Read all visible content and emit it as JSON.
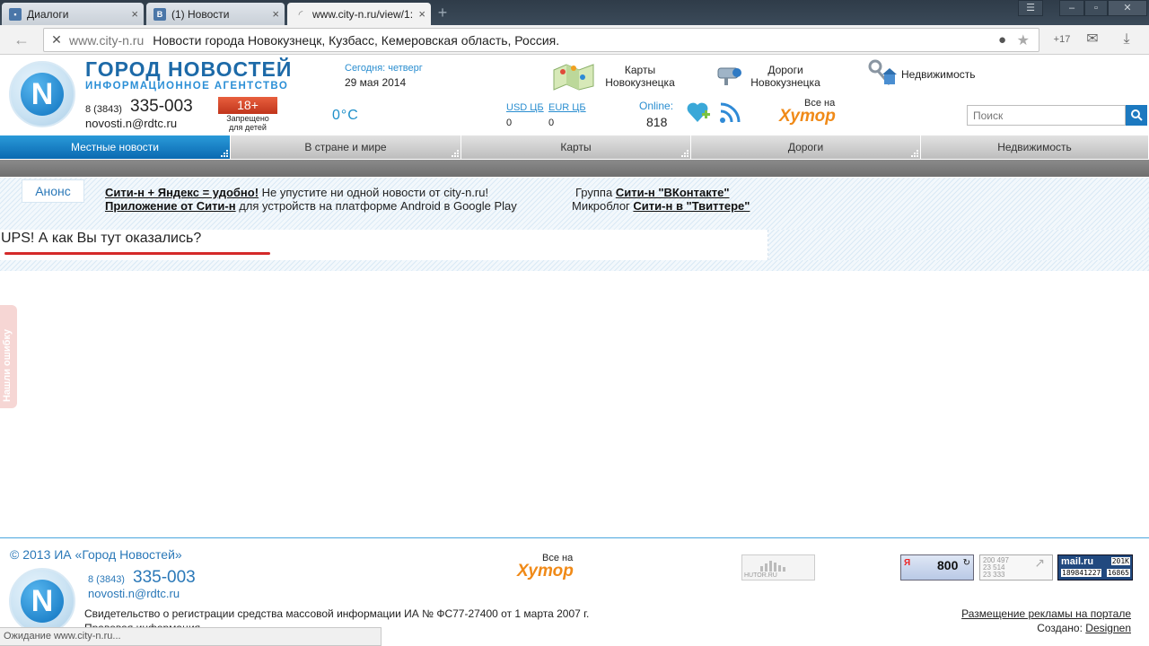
{
  "browser": {
    "tabs": [
      {
        "label": "Диалоги",
        "icon": "chat-icon",
        "color": "#4a76a8"
      },
      {
        "label": "(1) Новости",
        "icon": "vk-icon",
        "color": "#4a76a8"
      },
      {
        "label": "www.city-n.ru/view/1:",
        "icon": "loading-icon",
        "color": "#888888"
      }
    ],
    "address": {
      "host": "www.city-n.ru",
      "title": "Новости города Новокузнецк, Кузбасс, Кемеровская область, Россия."
    },
    "badge_count": "+17",
    "status": "Ожидание www.city-n.ru..."
  },
  "header": {
    "brand_title": "ГОРОД НОВОСТЕЙ",
    "brand_subtitle": "ИНФОРМАЦИОННОЕ АГЕНТСТВО",
    "date_label": "Сегодня: четверг",
    "date": "29 мая 2014",
    "top_links": [
      {
        "line1": "Карты",
        "line2": "Новокузнецка",
        "icon": "map-icon"
      },
      {
        "line1": "Дороги",
        "line2": "Новокузнецка",
        "icon": "camera-icon"
      },
      {
        "line1": "Недвижимость",
        "line2": "",
        "icon": "keys-icon"
      }
    ],
    "phone_code": "8 (3843)",
    "phone": "335-003",
    "email": "novosti.n@rdtc.ru",
    "age_rating": "18+",
    "age_text_1": "Запрещено",
    "age_text_2": "для детей",
    "temperature": "0°C",
    "currencies": [
      {
        "label": "USD ЦБ",
        "value": "0"
      },
      {
        "label": "EUR ЦБ",
        "value": "0"
      }
    ],
    "online_label": "Online:",
    "online_count": "818",
    "hutor_small": "Все на",
    "hutor_big": "Хутор",
    "search_placeholder": "Поиск"
  },
  "nav": {
    "items": [
      {
        "label": "Местные новости",
        "active": true
      },
      {
        "label": "В стране и мире",
        "active": false
      },
      {
        "label": "Карты",
        "active": false
      },
      {
        "label": "Дороги",
        "active": false
      },
      {
        "label": "Недвижимость",
        "active": false
      }
    ]
  },
  "announce": {
    "tab": "Анонс",
    "line1_bold": "Сити-н + Яндекс = удобно!",
    "line1_rest": " Не упустите ни одной новости от city-n.ru!",
    "line2_bold": "Приложение от Сити-н",
    "line2_rest": " для устройств на платформе Android в Google Play",
    "line3_pre": "Группа ",
    "line3_bold": "Сити-н \"ВКонтакте\"",
    "line4_pre": "Микроблог ",
    "line4_bold": "Сити-н в \"Твиттере\""
  },
  "main": {
    "error_message": "UPS! А как Вы тут оказались?",
    "feedback_tab": "Нашли ошибку"
  },
  "footer": {
    "copyright": "© 2013 ИА «Город Новостей»",
    "phone_code": "8 (3843)",
    "phone": "335-003",
    "email": "novosti.n@rdtc.ru",
    "certificate": "Свидетельство о регистрации средства массовой информации ИА № ФС77-27400 от 1 марта 2007 г.",
    "legal": "Правовая информация",
    "hutor_small": "Все на",
    "hutor_big": "Хутор",
    "counter_hutor": "HUTOR.RU",
    "counter_yandex": "800",
    "counter_li_1": "200 497",
    "counter_li_2": "23 514",
    "counter_li_3": "23 333",
    "counter_mail_brand": "mail.ru",
    "counter_mail_total": "189841227",
    "counter_mail_a": "201K",
    "counter_mail_b": "16865",
    "ad_link": "Размещение рекламы на портале",
    "made_by_label": "Создано:",
    "made_by": "Designen"
  }
}
